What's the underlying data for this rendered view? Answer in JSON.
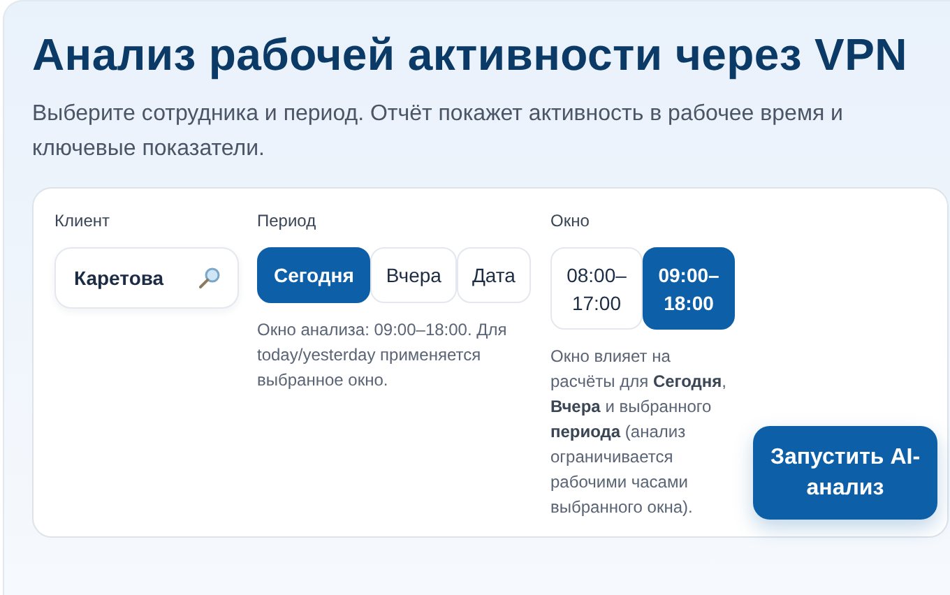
{
  "header": {
    "title": "Анализ рабочей активности через VPN",
    "subtitle": "Выберите сотрудника и период. Отчёт покажет активность в рабочее время и ключевые показатели."
  },
  "client": {
    "label": "Клиент",
    "value": "Каретова"
  },
  "period": {
    "label": "Период",
    "options": [
      {
        "label": "Сегодня",
        "selected": true
      },
      {
        "label": "Вчера",
        "selected": false
      },
      {
        "label": "Дата",
        "selected": false
      }
    ],
    "note": "Окно анализа: 09:00–18:00. Для today/yesterday применяется выбранное окно."
  },
  "window": {
    "label": "Окно",
    "options": [
      {
        "label": "08:00–17:00",
        "selected": false
      },
      {
        "label": "09:00–18:00",
        "selected": true
      }
    ],
    "note": "Окно влияет на расчёты для **Сегодня**, **Вчера** и выбранного **периода** (анализ ограничивается рабочими часами выбранного окна)."
  },
  "run_button": "Запустить AI-анализ"
}
